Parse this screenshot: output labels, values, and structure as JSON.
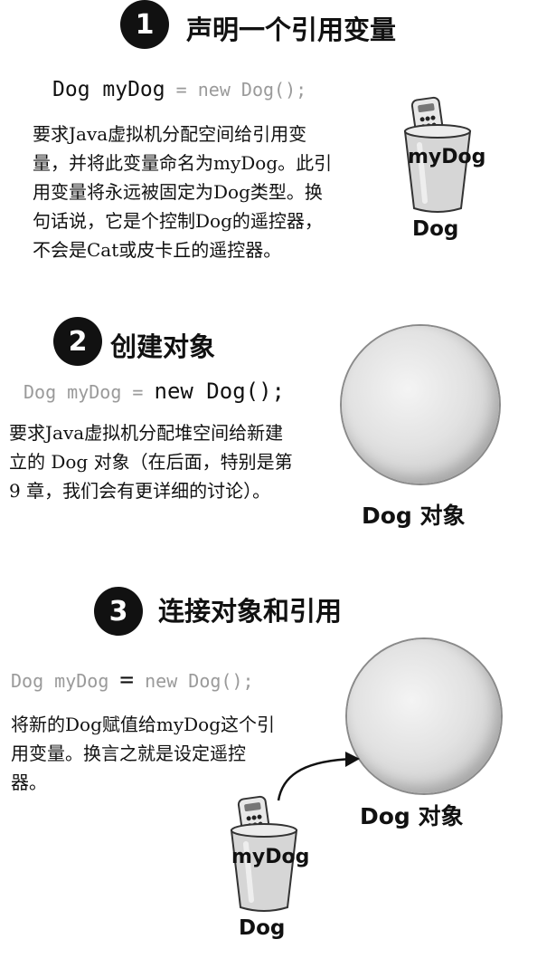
{
  "step1": {
    "number": "1",
    "title": "声明一个引用变量",
    "code": {
      "part1": "Dog myDog",
      "part2": " = new Dog();"
    },
    "lines": [
      "要求Java虚拟机分配空间给引用变",
      "量，并将此变量命名为myDog。此引",
      "用变量将永远被固定为Dog类型。换",
      "句话说，它是个控制Dog的遥控器，",
      "不会是Cat或皮卡丘的遥控器。"
    ],
    "cup_label": "myDog",
    "type_label": "Dog"
  },
  "step2": {
    "number": "2",
    "title": "创建对象",
    "code": {
      "part1": "Dog myDog = ",
      "part2": "new Dog();"
    },
    "lines": [
      "要求Java虚拟机分配堆空间给新建",
      "立的 Dog 对象（在后面，特别是第",
      "9 章，我们会有更详细的讨论）。"
    ],
    "object_label": "Dog 对象"
  },
  "step3": {
    "number": "3",
    "title": "连接对象和引用",
    "code": {
      "part1": "Dog myDog ",
      "part2": "=",
      "part3": " new Dog();"
    },
    "lines": [
      "将新的Dog赋值给myDog这个引",
      "用变量。换言之就是设定遥控",
      "器。"
    ],
    "object_label": "Dog 对象",
    "cup_label": "myDog",
    "type_label": "Dog"
  }
}
